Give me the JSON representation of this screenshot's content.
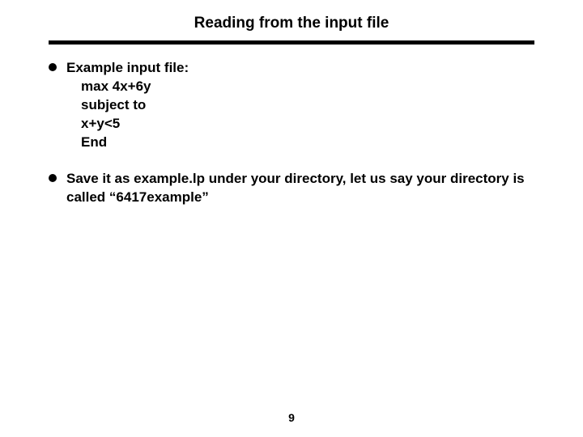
{
  "title": "Reading from the input file",
  "bullets": [
    {
      "lead": "Example input file:",
      "lines": [
        "max  4x+6y",
        "subject to",
        "x+y<5",
        "End"
      ]
    },
    {
      "lead": "Save it as example.lp under your directory, let us say your directory is called “6417example”",
      "lines": []
    }
  ],
  "page_number": "9"
}
